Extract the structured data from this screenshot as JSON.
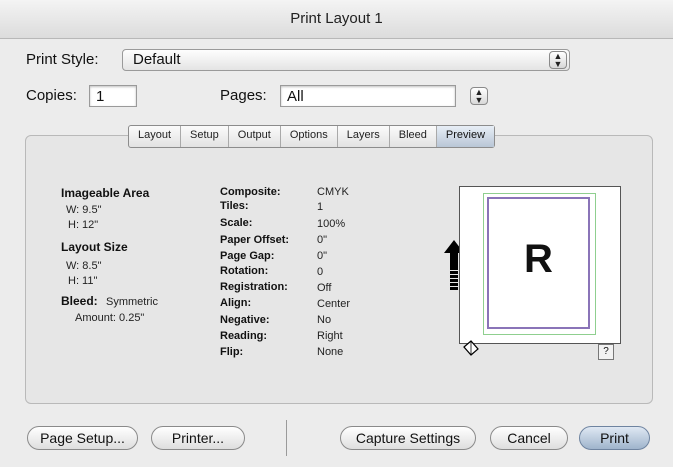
{
  "window": {
    "title": "Print Layout 1"
  },
  "print_style": {
    "label": "Print Style:",
    "value": "Default"
  },
  "copies": {
    "label": "Copies:",
    "value": "1"
  },
  "pages": {
    "label": "Pages:",
    "value": "All"
  },
  "tabs": [
    {
      "label": "Layout"
    },
    {
      "label": "Setup"
    },
    {
      "label": "Output"
    },
    {
      "label": "Options"
    },
    {
      "label": "Layers"
    },
    {
      "label": "Bleed"
    },
    {
      "label": "Preview",
      "active": true
    }
  ],
  "info": {
    "imageable_area": {
      "title": "Imageable Area",
      "w": "W: 9.5\"",
      "h": "H: 12\""
    },
    "layout_size": {
      "title": "Layout Size",
      "w": "W: 8.5\"",
      "h": "H: 11\""
    },
    "bleed": {
      "label": "Bleed:",
      "value": "Symmetric",
      "amount": "Amount: 0.25\""
    }
  },
  "settings": [
    {
      "key": "Composite:",
      "value": "CMYK"
    },
    {
      "key": "Tiles:",
      "value": "1"
    },
    {
      "key": "Scale:",
      "value": "100%"
    },
    {
      "key": "Paper Offset:",
      "value": "0\""
    },
    {
      "key": "Page Gap:",
      "value": "0\""
    },
    {
      "key": "Rotation:",
      "value": "0"
    },
    {
      "key": "Registration:",
      "value": "Off"
    },
    {
      "key": "Align:",
      "value": "Center"
    },
    {
      "key": "Negative:",
      "value": "No"
    },
    {
      "key": "Reading:",
      "value": "Right"
    },
    {
      "key": "Flip:",
      "value": "None"
    }
  ],
  "preview": {
    "letter": "R",
    "help": "?"
  },
  "buttons": {
    "page_setup": "Page Setup...",
    "printer": "Printer...",
    "capture": "Capture Settings",
    "cancel": "Cancel",
    "print": "Print"
  },
  "icons": {
    "popup_stepper": "up-down-arrows-icon",
    "feed_direction": "up-arrow-icon",
    "page_flip": "page-corner-icon"
  }
}
